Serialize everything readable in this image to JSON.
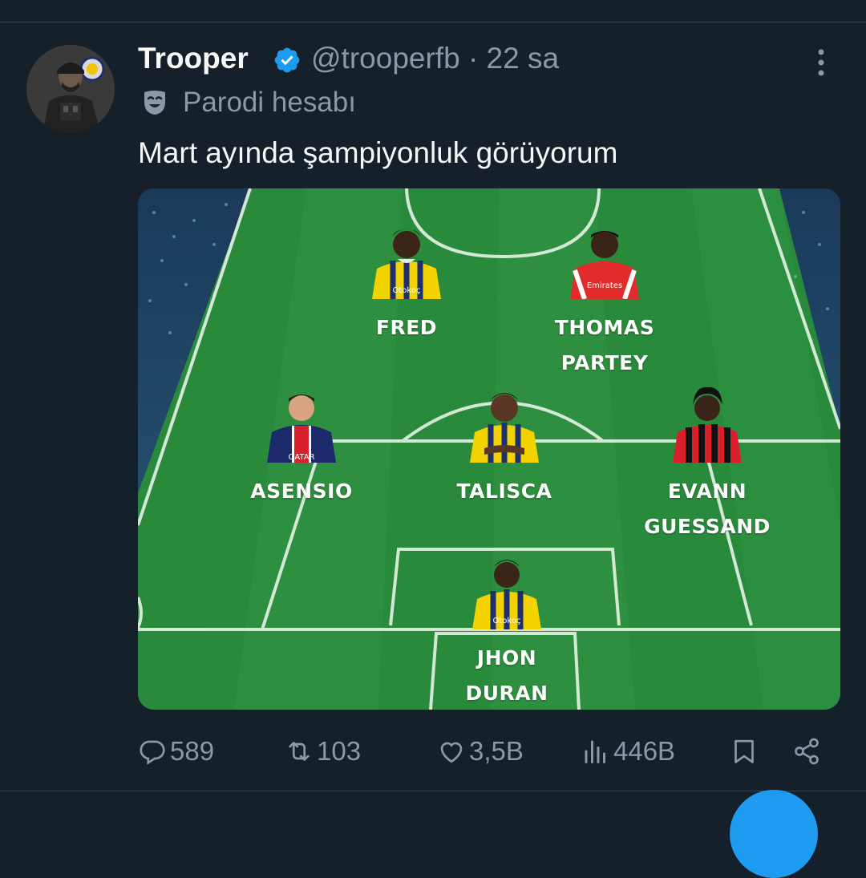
{
  "tweet": {
    "author_name": "Trooper",
    "handle": "@trooperfb",
    "time": "22 sa",
    "label": "Parodi hesabı",
    "text": "Mart ayında şampiyonluk görüyorum"
  },
  "lineup": [
    {
      "line1": "FRED",
      "line2": "",
      "kit": "fenerbahce"
    },
    {
      "line1": "THOMAS",
      "line2": "PARTEY",
      "kit": "arsenal"
    },
    {
      "line1": "ASENSIO",
      "line2": "",
      "kit": "psg"
    },
    {
      "line1": "TALISCA",
      "line2": "",
      "kit": "fenerbahce"
    },
    {
      "line1": "EVANN",
      "line2": "GUESSAND",
      "kit": "nice"
    },
    {
      "line1": "JHON",
      "line2": "DURAN",
      "kit": "fenerbahce"
    }
  ],
  "kit_texts": {
    "fenerbahce": "Otokoç",
    "arsenal": "Emirates",
    "psg": "QATAR"
  },
  "actions": {
    "replies": "589",
    "reposts": "103",
    "likes": "3,5B",
    "views": "446B"
  },
  "icons": {
    "verified": "verified-badge-icon",
    "parody": "parody-mask-icon",
    "more": "more-vertical-icon",
    "reply": "reply-icon",
    "repost": "repost-icon",
    "like": "heart-icon",
    "views": "views-chart-icon",
    "bookmark": "bookmark-icon",
    "share": "share-icon"
  },
  "colors": {
    "background": "#15202b",
    "text": "#f7f9f9",
    "secondary": "#8b98a5",
    "accent": "#1d9bf0",
    "pitch": "#2a8a3c"
  }
}
